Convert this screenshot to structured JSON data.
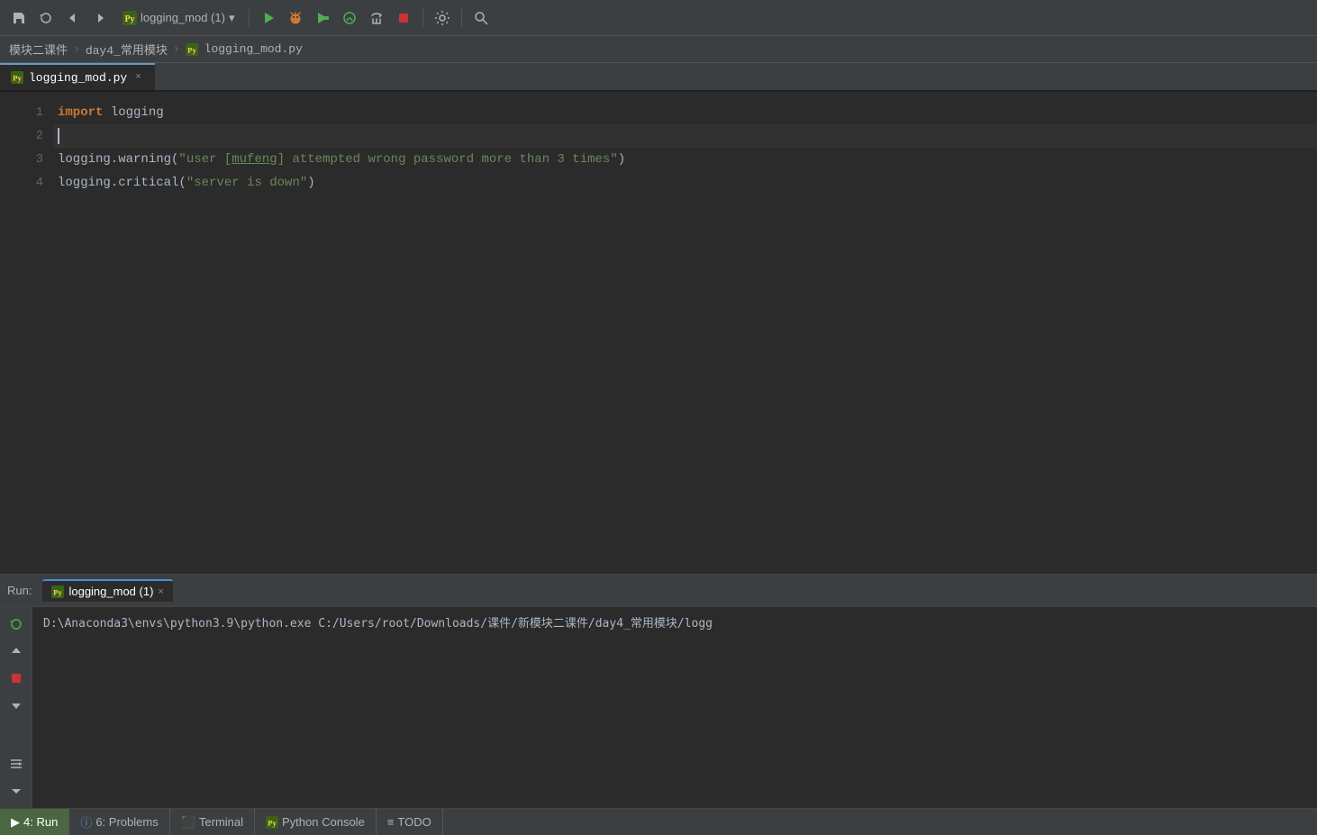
{
  "toolbar": {
    "run_config": "logging_mod (1)",
    "run_config_arrow": "▾"
  },
  "breadcrumb": {
    "items": [
      "模块二课件",
      "day4_常用模块",
      "logging_mod.py"
    ]
  },
  "editor_tab": {
    "label": "logging_mod.py",
    "close": "×"
  },
  "code": {
    "lines": [
      {
        "number": "1",
        "tokens": [
          {
            "type": "kw",
            "text": "import"
          },
          {
            "type": "plain",
            "text": " logging"
          }
        ]
      },
      {
        "number": "2",
        "tokens": [
          {
            "type": "cursor",
            "text": ""
          }
        ],
        "is_cursor": true
      },
      {
        "number": "3",
        "tokens": [
          {
            "type": "plain",
            "text": "logging.warning("
          },
          {
            "type": "str",
            "text": "\"user [mufeng] attempted wrong password more than 3 times\""
          },
          {
            "type": "plain",
            "text": ")"
          }
        ]
      },
      {
        "number": "4",
        "tokens": [
          {
            "type": "plain",
            "text": "logging.critical("
          },
          {
            "type": "str",
            "text": "\"server is down\""
          },
          {
            "type": "plain",
            "text": ")"
          }
        ]
      }
    ]
  },
  "run_panel": {
    "run_label": "Run:",
    "tab_label": "logging_mod (1)",
    "tab_close": "×",
    "output_line": "D:\\Anaconda3\\envs\\python3.9\\python.exe C:/Users/root/Downloads/课件/新模块二课件/day4_常用模块/logg"
  },
  "status_bar": {
    "items": [
      {
        "id": "run",
        "icon": "▶",
        "label": "4: Run",
        "active": true
      },
      {
        "id": "problems",
        "icon": "ⓘ",
        "label": "6: Problems",
        "active": false
      },
      {
        "id": "terminal",
        "icon": "⬜",
        "label": "Terminal",
        "active": false
      },
      {
        "id": "python-console",
        "icon": "🐍",
        "label": "Python Console",
        "active": false
      },
      {
        "id": "todo",
        "icon": "≡",
        "label": "TODO",
        "active": false
      }
    ]
  }
}
